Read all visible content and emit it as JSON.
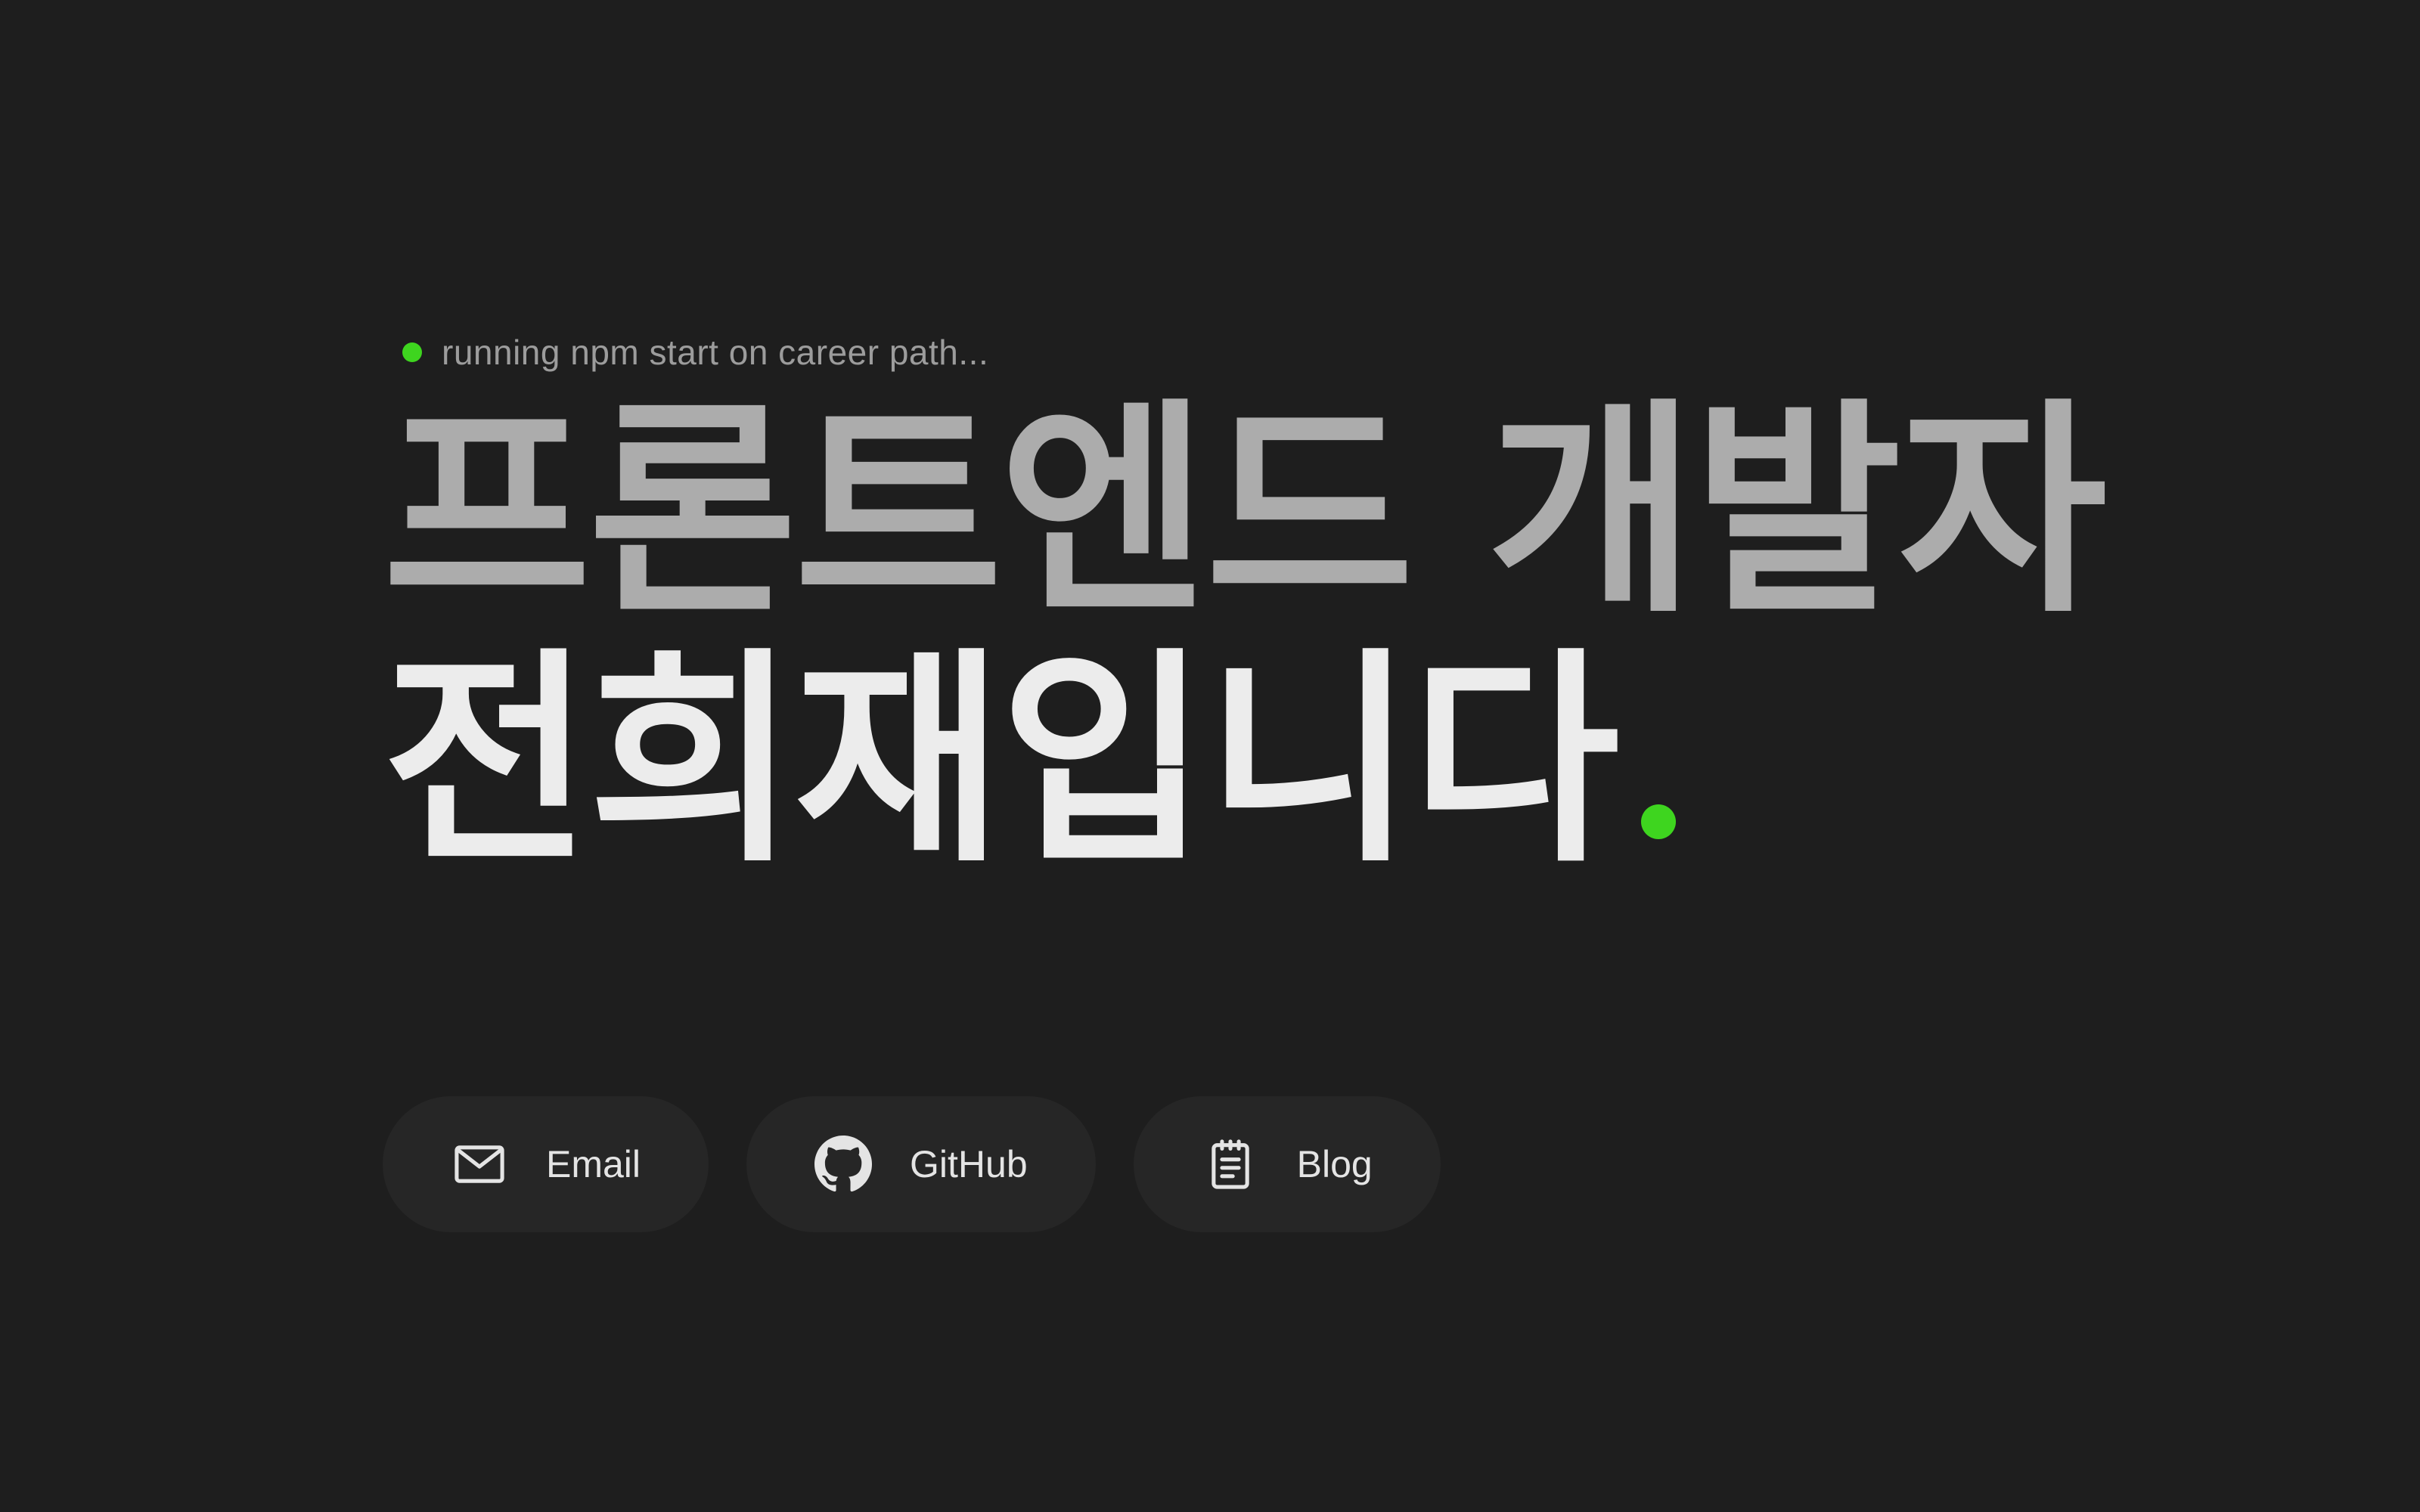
{
  "status": {
    "text": "running npm start on career path...",
    "dot_color": "#3ed51f"
  },
  "headline": {
    "line1": "프론트엔드 개발자",
    "line2": "전희재입니다",
    "line1_color": "#acacac",
    "line2_color": "#ececec",
    "accent_color": "#3ed51f"
  },
  "links": [
    {
      "label": "Email",
      "icon": "mail-icon"
    },
    {
      "label": "GitHub",
      "icon": "github-icon"
    },
    {
      "label": "Blog",
      "icon": "notepad-icon"
    }
  ],
  "colors": {
    "background": "#1e1e1e",
    "button_background": "#262626"
  }
}
